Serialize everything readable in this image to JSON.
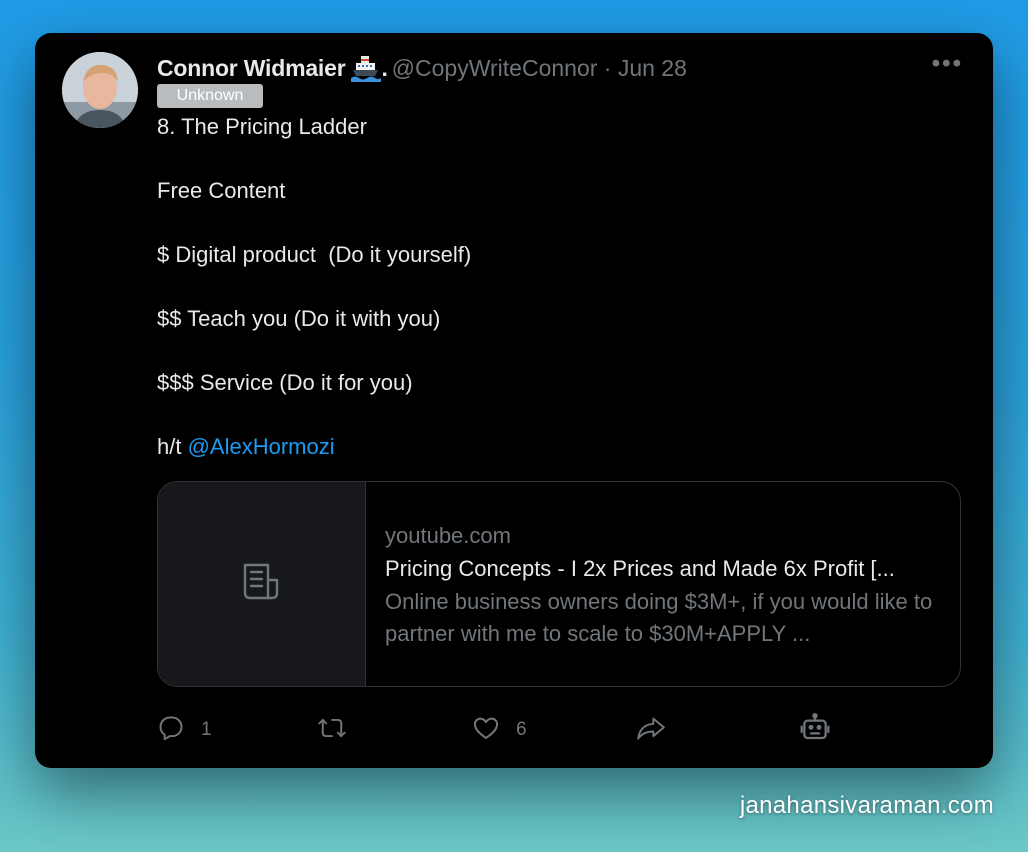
{
  "tweet": {
    "author_name": "Connor Widmaier",
    "author_suffix": ".",
    "handle_time": "@CopyWriteConnor · Jun 28",
    "badge": "Unknown",
    "lines": {
      "l1": "8. The Pricing Ladder",
      "l2": "Free Content",
      "l3": "$ Digital product  (Do it yourself)",
      "l4": "$$ Teach you (Do it with you)",
      "l5": "$$$ Service (Do it for you)",
      "l6_prefix": "h/t ",
      "l6_mention": "@AlexHormozi"
    },
    "more_icon": "more-horizontal-icon",
    "emoji_icon": "ship-icon"
  },
  "link_card": {
    "thumbnail_icon": "document-icon",
    "domain": "youtube.com",
    "title": "Pricing Concepts - I 2x Prices and Made 6x Profit [...",
    "description": "Online business owners doing $3M+, if you would like to partner with me to scale to $30M+APPLY ..."
  },
  "actions": {
    "reply_count": "1",
    "like_count": "6",
    "icons": [
      "reply-icon",
      "retweet-icon",
      "like-icon",
      "share-icon",
      "robot-icon"
    ]
  },
  "watermark": "janahansivaraman.com",
  "colors": {
    "background_top": "#1f9be6",
    "card": "#000000",
    "text": "#e7e9ea",
    "muted": "#71767b",
    "mention": "#1d9bf0"
  }
}
